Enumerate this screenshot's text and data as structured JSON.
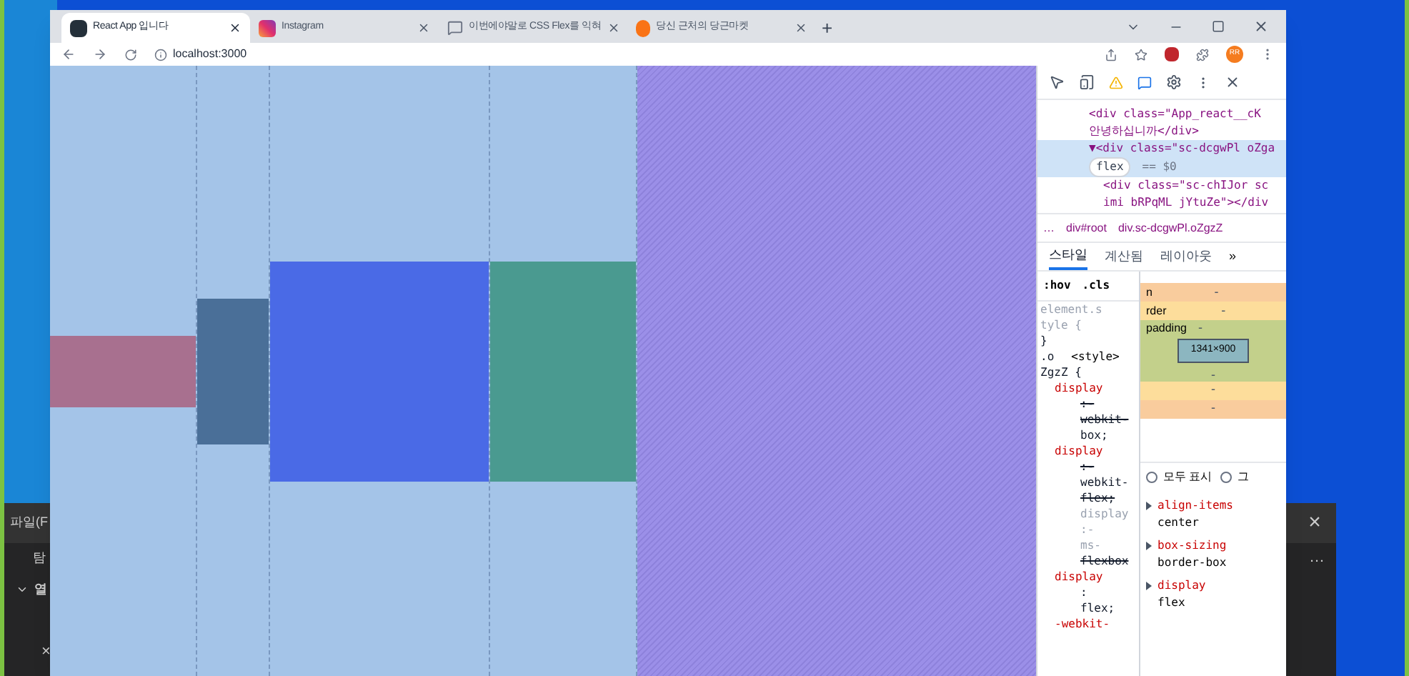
{
  "back_window": {
    "menu": "파일(F",
    "items": [
      "탐",
      "열"
    ],
    "left_close": "×",
    "right_close": "×",
    "more": "…"
  },
  "browser": {
    "tabs": [
      {
        "title": "React App 입니다",
        "selected": true,
        "kind": "app"
      },
      {
        "title": "Instagram",
        "selected": false,
        "kind": "camera"
      },
      {
        "title": "이번에야말로 CSS Flex를 익혀",
        "selected": false,
        "kind": "chat"
      },
      {
        "title": "당신 근처의 당근마켓",
        "selected": false,
        "kind": "carrot"
      }
    ],
    "new_tab": "+",
    "address": "localhost:3000",
    "avatar": "RR"
  },
  "page": {
    "columns": [
      {
        "color": "#a8708f",
        "kind": "small"
      },
      {
        "color": "#4a6f98",
        "kind": "medium"
      },
      {
        "color": "#4a6ae6",
        "kind": "large"
      },
      {
        "color": "#4a9a90",
        "kind": "large"
      }
    ]
  },
  "devtools": {
    "elements": [
      {
        "text": "<div class=\"App_react__cK",
        "selected": false,
        "kind": "parent"
      },
      {
        "text": "안녕하십니까</div>",
        "selected": false,
        "kind": "parent"
      },
      {
        "text": "▼<div class=\"sc-dcgwPl oZga",
        "selected": true,
        "kind": "parent",
        "badge": "flex",
        "ref": "== $0"
      },
      {
        "text": "<div class=\"sc-chIJor sc",
        "selected": false,
        "kind": "child"
      },
      {
        "text": "imi bRPqML jYtuZe\"></div",
        "selected": false,
        "kind": "child"
      }
    ],
    "breadcrumbs": [
      "…",
      "div#root",
      "div.sc-dcgwPl.oZgzZ"
    ],
    "tabs": [
      {
        "label": "스타일",
        "selected": true
      },
      {
        "label": "계산됨",
        "selected": false
      },
      {
        "label": "레이아웃",
        "selected": false
      }
    ],
    "more_tabs": "»",
    "filter": [
      ":hov",
      ".cls"
    ],
    "styles": [
      {
        "text": "element.s",
        "kind": "faded"
      },
      {
        "text": "tyle {",
        "kind": "faded"
      },
      {
        "text": "}",
        "kind": "plain"
      },
      {
        "text": ".o",
        "kind": "plain",
        "side": "<style>"
      },
      {
        "text": "ZgzZ {",
        "kind": "plain"
      },
      {
        "text": "display",
        "kind": "prop"
      },
      {
        "text": ":-",
        "kind": "struck"
      },
      {
        "text": "webkit-",
        "kind": "struck"
      },
      {
        "text": "box;",
        "kind": "value"
      },
      {
        "text": "display",
        "kind": "prop"
      },
      {
        "text": ":-",
        "kind": "struck"
      },
      {
        "text": "webkit-",
        "kind": "value"
      },
      {
        "text": "flex;",
        "kind": "struck"
      },
      {
        "text": "display",
        "kind": "faded"
      },
      {
        "text": ":-",
        "kind": "faded"
      },
      {
        "text": "ms-",
        "kind": "faded"
      },
      {
        "text": "flexbox",
        "kind": "struck"
      },
      {
        "text": "display",
        "kind": "prop"
      },
      {
        "text": ":",
        "kind": "value"
      },
      {
        "text": "flex;",
        "kind": "value"
      },
      {
        "text": "-webkit-",
        "kind": "prop"
      }
    ],
    "box_model": {
      "margin_label": "n",
      "border_label": "rder",
      "padding_label": "padding",
      "size": "1341×900",
      "dash": "-"
    },
    "checkboxes": [
      {
        "label": "모두 표시",
        "checked": false
      },
      {
        "label": "그",
        "checked": false
      }
    ],
    "computed": [
      {
        "name": "align-items",
        "value": "center"
      },
      {
        "name": "box-sizing",
        "value": "border-box"
      },
      {
        "name": "display",
        "value": "flex"
      }
    ]
  }
}
